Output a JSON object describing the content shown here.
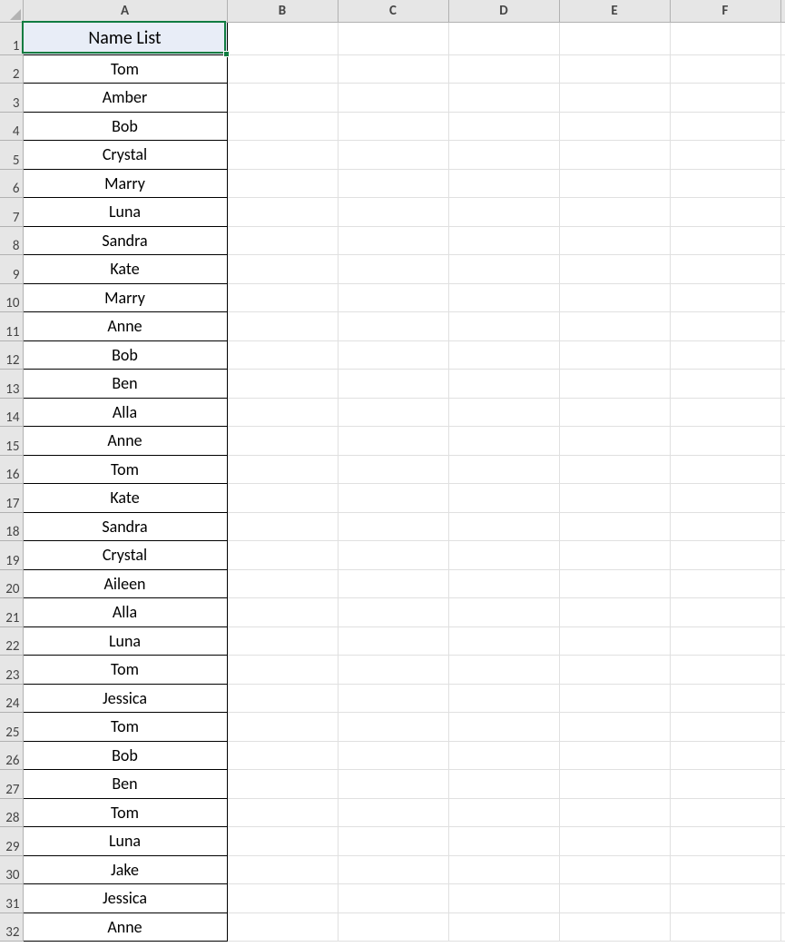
{
  "columns": [
    "A",
    "B",
    "C",
    "D",
    "E",
    "F"
  ],
  "header_row_number": "1",
  "header_cell_value": "Name List",
  "names": [
    "Tom",
    "Amber",
    "Bob",
    "Crystal",
    "Marry",
    "Luna",
    "Sandra",
    "Kate",
    "Marry",
    "Anne",
    "Bob",
    "Ben",
    "Alla",
    "Anne",
    "Tom",
    "Kate",
    "Sandra",
    "Crystal",
    "Aileen",
    "Alla",
    "Luna",
    "Tom",
    "Jessica",
    "Tom",
    "Bob",
    "Ben",
    "Tom",
    "Luna",
    "Jake",
    "Jessica",
    "Anne"
  ],
  "selected_cell": {
    "row": 1,
    "col": "A"
  }
}
